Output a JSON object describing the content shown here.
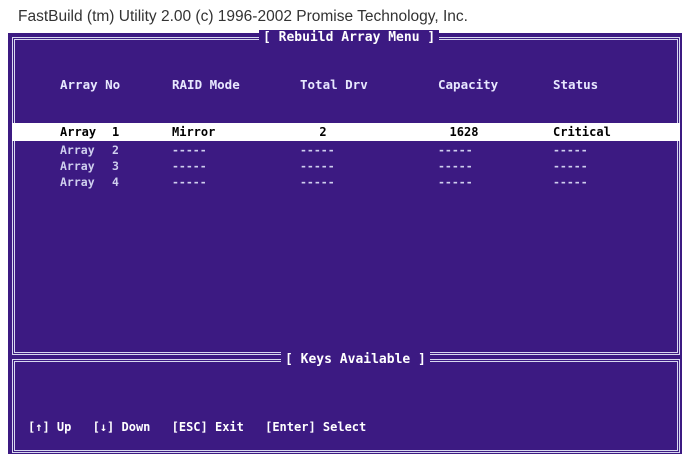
{
  "window": {
    "title": "FastBuild (tm) Utility 2.00 (c) 1996-2002 Promise Technology, Inc."
  },
  "menu": {
    "title": "[ Rebuild Array Menu ]",
    "columns": {
      "array_no": "Array No",
      "raid_mode": "RAID Mode",
      "total_drv": "Total Drv",
      "capacity": "Capacity",
      "status": "Status"
    },
    "rows": [
      {
        "array": "Array",
        "no": "1",
        "raid_mode": "Mirror",
        "total_drv": "2",
        "capacity": "1628",
        "status": "Critical",
        "selected": true
      },
      {
        "array": "Array",
        "no": "2",
        "raid_mode": "-----",
        "total_drv": "-----",
        "capacity": "-----",
        "status": "-----",
        "selected": false
      },
      {
        "array": "Array",
        "no": "3",
        "raid_mode": "-----",
        "total_drv": "-----",
        "capacity": "-----",
        "status": "-----",
        "selected": false
      },
      {
        "array": "Array",
        "no": "4",
        "raid_mode": "-----",
        "total_drv": "-----",
        "capacity": "-----",
        "status": "-----",
        "selected": false
      }
    ]
  },
  "keys": {
    "title": "[ Keys Available ]",
    "items": [
      {
        "label": "[↑] Up"
      },
      {
        "label": "[↓] Down"
      },
      {
        "label": "[ESC] Exit"
      },
      {
        "label": "[Enter] Select"
      }
    ]
  },
  "colors": {
    "screen_bg": "#3c1a82",
    "highlight_bg": "#ffffff",
    "frame": "#d8d8f0"
  }
}
